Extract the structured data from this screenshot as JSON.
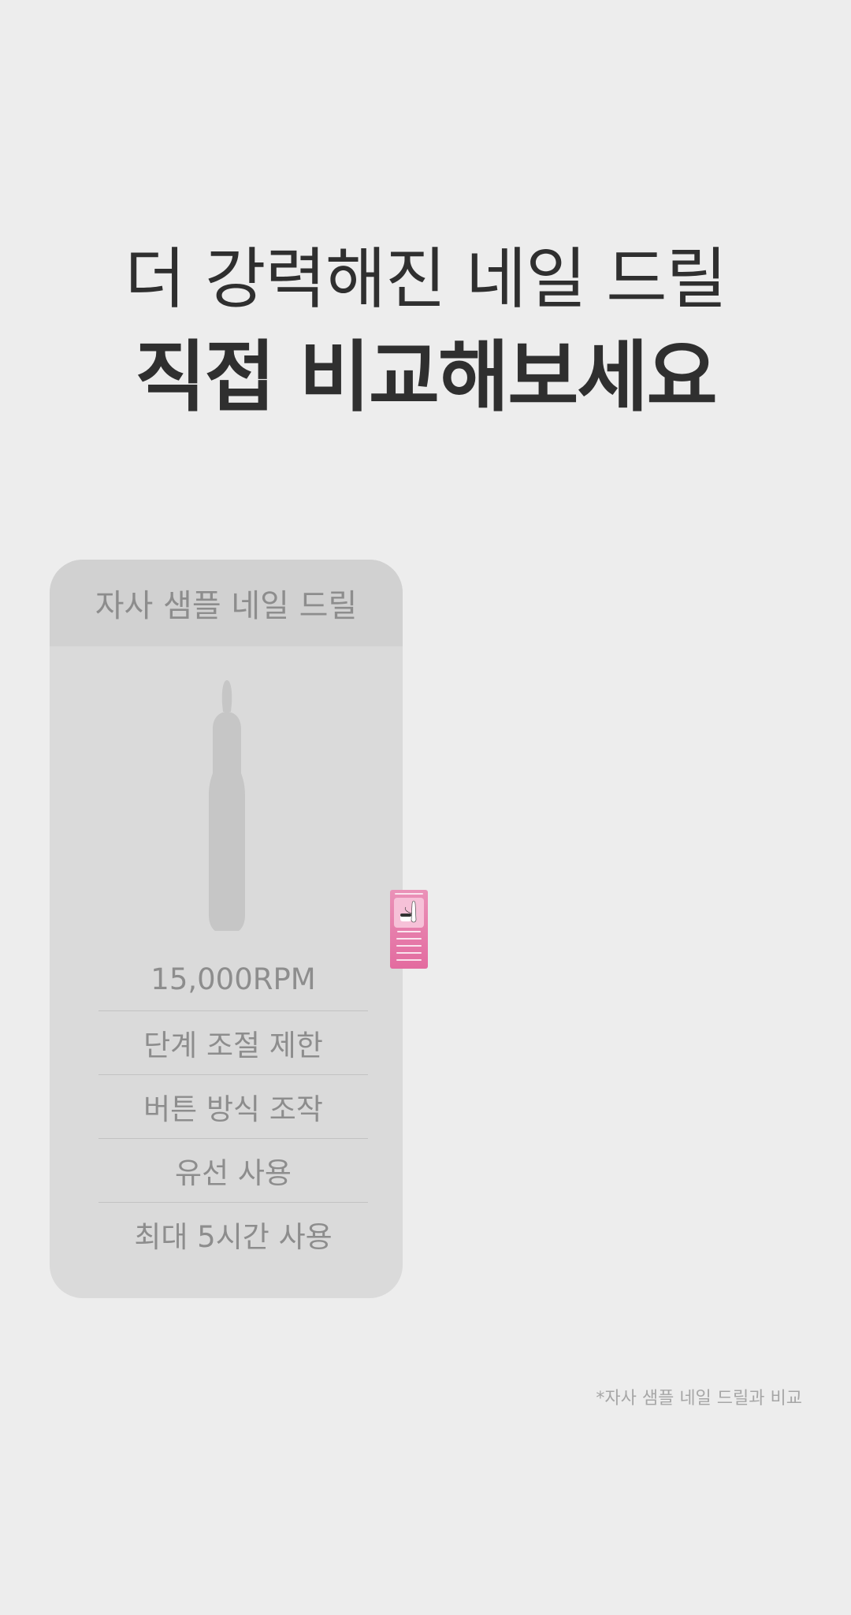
{
  "headline": {
    "line1": "더 강력해진 네일 드릴",
    "line2": "직접 비교해보세요"
  },
  "comparison_card": {
    "title": "자사 샘플 네일 드릴",
    "product_image": "nail-drill-silhouette",
    "specs": [
      "15,000RPM",
      "단계 조절 제한",
      "버튼 방식 조작",
      "유선 사용",
      "최대 5시간 사용"
    ]
  },
  "thumbnail": {
    "image": "pink-product-comparison-thumbnail"
  },
  "footnote": "*자사 샘플 네일 드릴과 비교",
  "colors": {
    "background": "#ededed",
    "card_body": "#dadada",
    "card_header": "#d1d1d1",
    "headline_text": "#2f2f2f",
    "card_text": "#8d8d8d",
    "footnote_text": "#a6a6a6",
    "thumbnail_pink": "#e36b9f"
  }
}
